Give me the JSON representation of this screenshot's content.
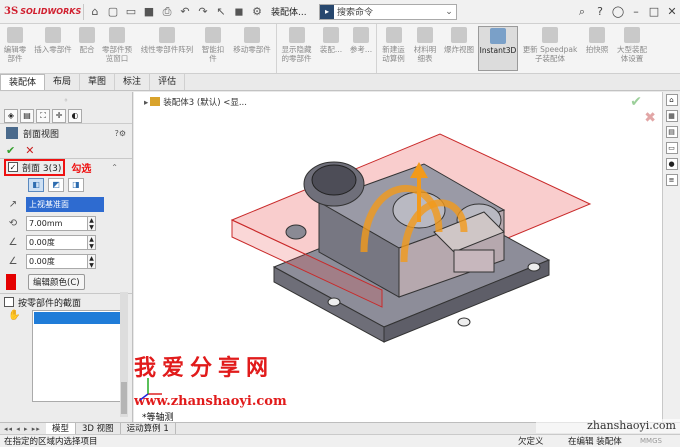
{
  "app": {
    "logo_ds": "3S",
    "logo_text": "SOLIDWORKS",
    "doc_title": "装配体...",
    "search_placeholder": "搜索命令"
  },
  "ribbon": {
    "buttons": [
      {
        "label": "编辑零\n部件",
        "icon": "edit-component-icon"
      },
      {
        "label": "插入零部件",
        "icon": "insert-component-icon"
      },
      {
        "label": "配合",
        "icon": "mate-icon"
      },
      {
        "label": "零部件预\n览窗口",
        "icon": "preview-window-icon"
      },
      {
        "label": "线性零部件阵列",
        "icon": "linear-pattern-icon"
      },
      {
        "label": "智能扣\n件",
        "icon": "smart-fastener-icon"
      },
      {
        "label": "移动零部件",
        "icon": "move-component-icon"
      },
      {
        "label": "显示隐藏\n的零部件",
        "icon": "show-hidden-icon"
      },
      {
        "label": "装配...",
        "icon": "assembly-features-icon"
      },
      {
        "label": "参考...",
        "icon": "reference-geometry-icon"
      },
      {
        "label": "新建运\n动算例",
        "icon": "new-motion-study-icon"
      },
      {
        "label": "材料明\n细表",
        "icon": "bom-icon"
      },
      {
        "label": "爆炸视图",
        "icon": "exploded-view-icon"
      },
      {
        "label": "Instant3D",
        "icon": "instant3d-icon"
      },
      {
        "label": "更新 Speedpak\n子装配体",
        "icon": "speedpak-icon"
      },
      {
        "label": "拍快照",
        "icon": "snapshot-icon"
      },
      {
        "label": "大型装配\n体设置",
        "icon": "large-assembly-icon"
      }
    ]
  },
  "tabs": [
    "装配体",
    "布局",
    "草图",
    "标注",
    "评估"
  ],
  "property_manager": {
    "title": "剖面视图",
    "section": {
      "label": "剖面 3(3)",
      "annotation": "勾选",
      "plane": "上视基准面",
      "offset": "7.00mm",
      "angle_x": "0.00度",
      "angle_y": "0.00度",
      "edit_color": "编辑颜色(C)"
    },
    "by_component": {
      "label": "按零部件的截面"
    }
  },
  "viewport": {
    "tree_label": "装配体3 (默认) <显...",
    "view_label": "*等轴测",
    "watermark_text": "我爱分享网",
    "watermark_url": "www.zhanshaoyi.com"
  },
  "bottom_tabs": [
    "模型",
    "3D 视图",
    "运动算例 1"
  ],
  "status": {
    "message": "在指定的区域内选择项目",
    "state1": "欠定义",
    "state2": "在编辑 装配体",
    "units": "MMGS",
    "site": "zhanshaoyi.com"
  }
}
